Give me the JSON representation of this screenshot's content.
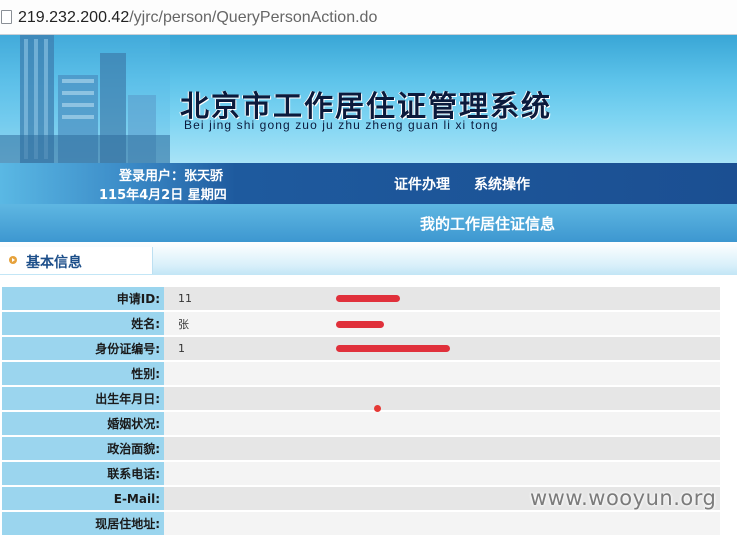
{
  "browser": {
    "url_host": "219.232.200.42",
    "url_path": "/yjrc/person/QueryPersonAction.do"
  },
  "header": {
    "title": "北京市工作居住证管理系统",
    "pinyin": "Bei jing shi gong zuo ju zhu zheng guan li xi tong"
  },
  "nav": {
    "user_label": "登录用户：张天骄",
    "date_label": "115年4月2日 星期四",
    "menu_items": [
      "证件办理",
      "系统操作"
    ]
  },
  "subheader": {
    "title": "我的工作居住证信息"
  },
  "section": {
    "tab_label": "基本信息"
  },
  "fields": [
    {
      "label": "申请ID:",
      "value": "11"
    },
    {
      "label": "姓名:",
      "value": "张"
    },
    {
      "label": "身份证编号:",
      "value": "1"
    },
    {
      "label": "性别:",
      "value": ""
    },
    {
      "label": "出生年月日:",
      "value": ""
    },
    {
      "label": "婚姻状况:",
      "value": ""
    },
    {
      "label": "政治面貌:",
      "value": ""
    },
    {
      "label": "联系电话:",
      "value": ""
    },
    {
      "label": "E-Mail:",
      "value": ""
    },
    {
      "label": "现居住地址:",
      "value": ""
    }
  ],
  "watermark": "www.wooyun.org",
  "colors": {
    "nav_dark": "#1b4f92",
    "label_cell": "#9bd5ee",
    "redaction": "#e0303b"
  }
}
